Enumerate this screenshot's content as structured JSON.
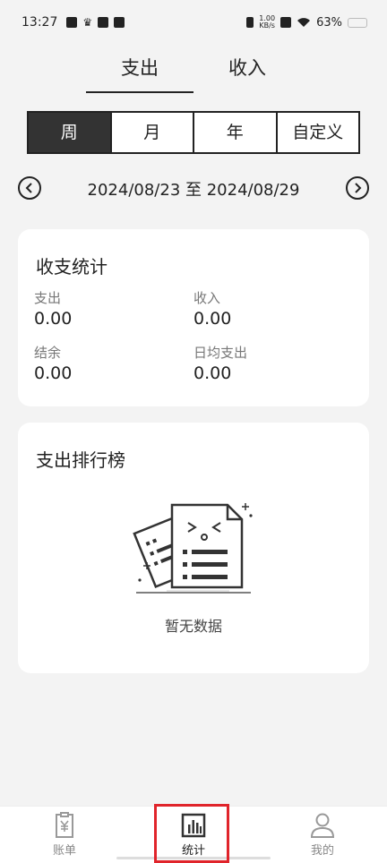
{
  "status_bar": {
    "time": "13:27",
    "speed_top": "1.00",
    "speed_bottom": "KB/s",
    "battery_pct": "63%",
    "battery_level": 0.63
  },
  "top_tabs": [
    {
      "label": "支出",
      "active": true
    },
    {
      "label": "收入",
      "active": false
    }
  ],
  "period_tabs": [
    {
      "label": "周"
    },
    {
      "label": "月"
    },
    {
      "label": "年"
    },
    {
      "label": "自定义"
    }
  ],
  "date_range": {
    "text": "2024/08/23 至 2024/08/29",
    "prev_icon": "chevron-left-icon",
    "next_icon": "chevron-right-icon"
  },
  "stats_card": {
    "title": "收支统计",
    "expense_label": "支出",
    "expense_value": "0.00",
    "income_label": "收入",
    "income_value": "0.00",
    "balance_label": "结余",
    "balance_value": "0.00",
    "daily_label": "日均支出",
    "daily_value": "0.00"
  },
  "ranking_card": {
    "title": "支出排行榜",
    "empty_text": "暂无数据"
  },
  "bottom_nav": [
    {
      "label": "账单",
      "icon": "bill-icon"
    },
    {
      "label": "统计",
      "icon": "chart-icon"
    },
    {
      "label": "我的",
      "icon": "person-icon"
    }
  ],
  "colors": {
    "active_bg": "#333333",
    "highlight": "#e0242b",
    "battery": "#f5b800"
  }
}
